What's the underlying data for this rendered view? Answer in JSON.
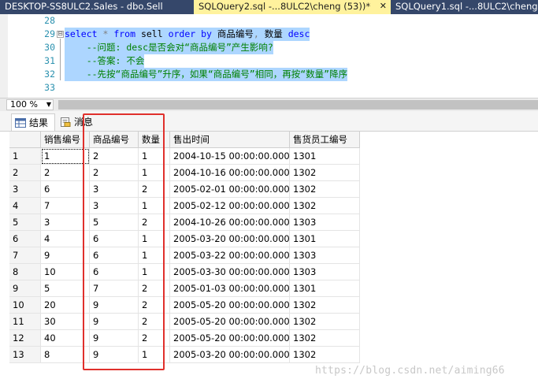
{
  "tabs": [
    {
      "label": "DESKTOP-SS8ULC2.Sales - dbo.Sell"
    },
    {
      "label": "SQLQuery2.sql -...8ULC2\\cheng (53))*",
      "close": "✕"
    },
    {
      "label": "SQLQuery1.sql -...8ULC2\\cheng"
    }
  ],
  "editor": {
    "lines": [
      {
        "num": "28"
      },
      {
        "num": "29",
        "fold": "⊟",
        "seg": [
          {
            "t": "select ",
            "c": "kw"
          },
          {
            "t": "* ",
            "c": "gray"
          },
          {
            "t": "from ",
            "c": "kw"
          },
          {
            "t": "sell ",
            "c": "plain"
          },
          {
            "t": "order by ",
            "c": "kw"
          },
          {
            "t": "商品编号",
            "c": "plain"
          },
          {
            "t": ", ",
            "c": "gray"
          },
          {
            "t": "数量 ",
            "c": "plain"
          },
          {
            "t": "desc",
            "c": "kw"
          }
        ]
      },
      {
        "num": "30",
        "seg": [
          {
            "t": "    --问题: desc是否会对“商品编号”产生影响?",
            "c": "cm"
          }
        ]
      },
      {
        "num": "31",
        "seg": [
          {
            "t": "    --答案: 不会",
            "c": "cm"
          }
        ]
      },
      {
        "num": "32",
        "seg": [
          {
            "t": "    --先按“商品编号”升序，如果“商品编号”相同，再按“数量”降序",
            "c": "cm"
          }
        ]
      },
      {
        "num": "33"
      }
    ]
  },
  "zoom": {
    "value": "100 %",
    "arrow": "▼"
  },
  "result_tabs": {
    "results": "结果",
    "messages": "消息"
  },
  "grid": {
    "headers": [
      "",
      "销售编号",
      "商品编号",
      "数量",
      "售出时间",
      "售货员工编号"
    ],
    "rows": [
      [
        "1",
        "1",
        "2",
        "1",
        "2004-10-15 00:00:00.000",
        "1301"
      ],
      [
        "2",
        "2",
        "2",
        "1",
        "2004-10-16 00:00:00.000",
        "1302"
      ],
      [
        "3",
        "6",
        "3",
        "2",
        "2005-02-01 00:00:00.000",
        "1302"
      ],
      [
        "4",
        "7",
        "3",
        "1",
        "2005-02-12 00:00:00.000",
        "1302"
      ],
      [
        "5",
        "3",
        "5",
        "2",
        "2004-10-26 00:00:00.000",
        "1303"
      ],
      [
        "6",
        "4",
        "6",
        "1",
        "2005-03-20 00:00:00.000",
        "1301"
      ],
      [
        "7",
        "9",
        "6",
        "1",
        "2005-03-22 00:00:00.000",
        "1303"
      ],
      [
        "8",
        "10",
        "6",
        "1",
        "2005-03-30 00:00:00.000",
        "1303"
      ],
      [
        "9",
        "5",
        "7",
        "2",
        "2005-01-03 00:00:00.000",
        "1301"
      ],
      [
        "10",
        "20",
        "9",
        "2",
        "2005-05-20 00:00:00.000",
        "1302"
      ],
      [
        "11",
        "30",
        "9",
        "2",
        "2005-05-20 00:00:00.000",
        "1302"
      ],
      [
        "12",
        "40",
        "9",
        "2",
        "2005-05-20 00:00:00.000",
        "1302"
      ],
      [
        "13",
        "8",
        "9",
        "1",
        "2005-03-20 00:00:00.000",
        "1302"
      ]
    ]
  },
  "watermark": "https://blog.csdn.net/aiming66",
  "colors": {
    "highlight": "#add6ff",
    "redbox": "#e0302c",
    "keyword": "#0000ff",
    "comment": "#008000"
  }
}
